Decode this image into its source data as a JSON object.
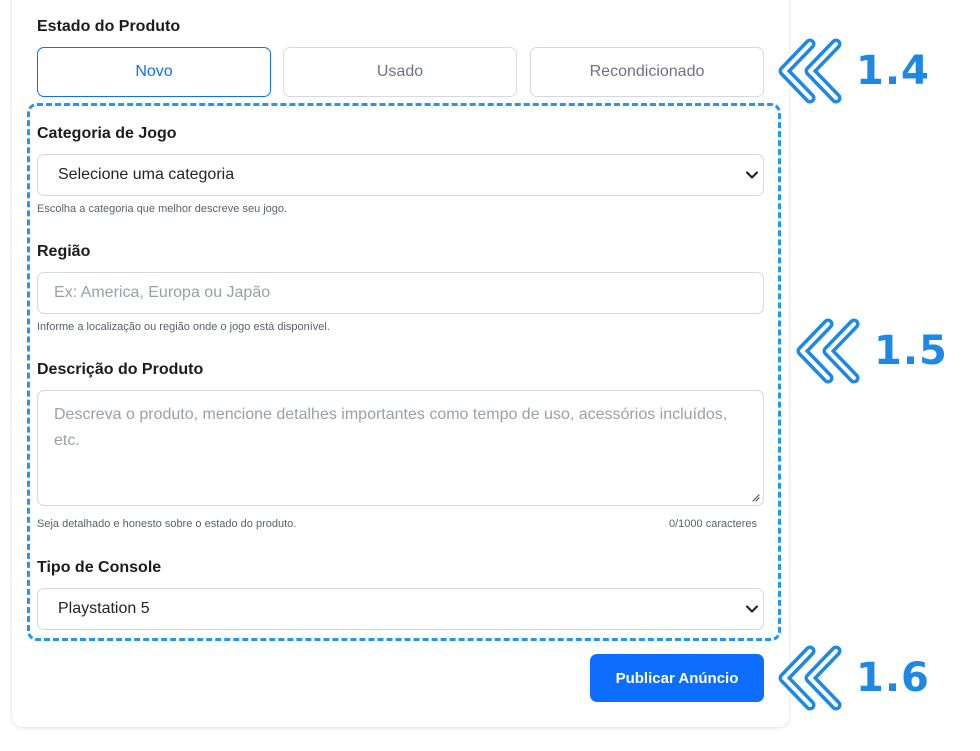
{
  "estado": {
    "title": "Estado do Produto",
    "options": [
      "Novo",
      "Usado",
      "Recondicionado"
    ],
    "selected": "Novo"
  },
  "categoria": {
    "label": "Categoria de Jogo",
    "value": "Selecione uma categoria",
    "help": "Escolha a categoria que melhor descreve seu jogo."
  },
  "regiao": {
    "label": "Região",
    "placeholder": "Ex: America, Europa ou Japão",
    "help": "Informe a localização ou região onde o jogo está disponível."
  },
  "descricao": {
    "label": "Descrição do Produto",
    "placeholder": "Descreva o produto, mencione detalhes importantes como tempo de uso, acessórios incluídos, etc.",
    "help": "Seja detalhado e honesto sobre o estado do produto.",
    "counter": "0/1000 caracteres"
  },
  "console": {
    "label": "Tipo de Console",
    "value": "Playstation 5"
  },
  "submit_label": "Publicar Anúncio",
  "markers": [
    "1.4",
    "1.5",
    "1.6"
  ],
  "colors": {
    "primary": "#0d6efd",
    "annotation": "#2196f3",
    "border": "#d5d8dc"
  }
}
